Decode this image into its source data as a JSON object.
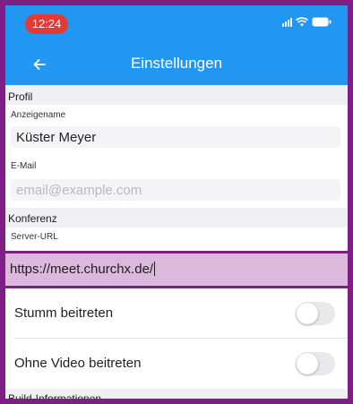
{
  "status_bar": {
    "time": "12:24",
    "time_pill_color": "#e53935"
  },
  "nav": {
    "title": "Einstellungen",
    "back_icon": "arrow-left-icon",
    "bar_color": "#2196f3"
  },
  "profile": {
    "section_title": "Profil",
    "display_name_label": "Anzeigename",
    "display_name_value": "Küster Meyer",
    "email_label": "E-Mail",
    "email_placeholder": "email@example.com"
  },
  "conference": {
    "section_title": "Konferenz",
    "server_url_label": "Server-URL",
    "server_url_value": "https://meet.churchx.de/",
    "highlight_color": "#dcb8dc",
    "join_muted_label": "Stumm beitreten",
    "join_muted_on": false,
    "join_no_video_label": "Ohne Video beitreten",
    "join_no_video_on": false
  },
  "build": {
    "section_title": "Build-Informationen"
  }
}
